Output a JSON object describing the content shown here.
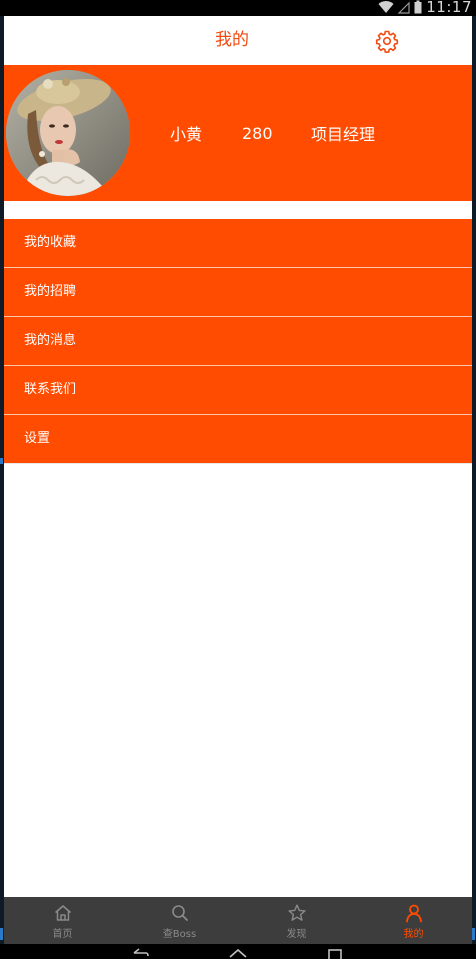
{
  "status_bar": {
    "time": "11:17"
  },
  "header": {
    "title": "我的"
  },
  "profile": {
    "name": "小黄",
    "count": "280",
    "role": "项目经理"
  },
  "menu": {
    "items": [
      {
        "label": "我的收藏"
      },
      {
        "label": "我的招聘"
      },
      {
        "label": "我的消息"
      },
      {
        "label": "联系我们"
      },
      {
        "label": "设置"
      }
    ]
  },
  "tabs": [
    {
      "label": "首页",
      "icon": "home-icon"
    },
    {
      "label": "查Boss",
      "icon": "search-icon"
    },
    {
      "label": "发现",
      "icon": "star-icon"
    },
    {
      "label": "我的",
      "icon": "user-icon",
      "active": true
    }
  ],
  "colors": {
    "accent": "#ff4c00",
    "tab_bar": "#3d3d3d",
    "title": "#f04a0e"
  }
}
